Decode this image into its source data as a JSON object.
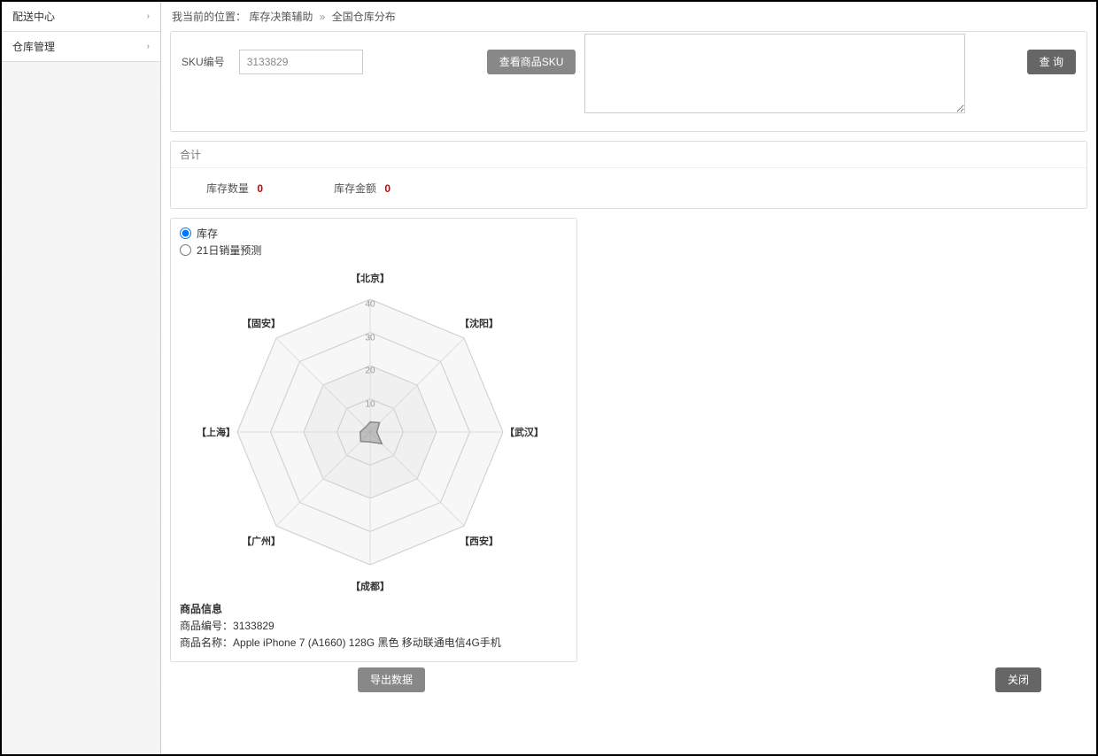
{
  "sidebar": {
    "items": [
      {
        "label": "配送中心"
      },
      {
        "label": "仓库管理"
      }
    ]
  },
  "breadcrumb": {
    "prefix": "我当前的位置：",
    "part1": "库存决策辅助",
    "sep": "»",
    "part2": "全国仓库分布"
  },
  "search": {
    "sku_label": "SKU编号",
    "sku_value": "3133829",
    "btn_view_sku": "查看商品SKU",
    "notes_value": "",
    "btn_search": "查 询"
  },
  "stats": {
    "header": "合计",
    "qty_label": "库存数量",
    "qty_value": "0",
    "amt_label": "库存金额",
    "amt_value": "0"
  },
  "chart": {
    "radio_stock": "库存",
    "radio_sales": "21日销量预测"
  },
  "chart_data": {
    "type": "radar",
    "categories": [
      "【北京】",
      "【沈阳】",
      "【武汉】",
      "【西安】",
      "【成都】",
      "【广州】",
      "【上海】",
      "【固安】"
    ],
    "rings": [
      10,
      20,
      30,
      40
    ],
    "series": [
      {
        "name": "库存",
        "values": [
          3,
          4,
          2,
          5,
          3,
          4,
          3,
          2
        ]
      }
    ]
  },
  "prod": {
    "title": "商品信息",
    "code_label": "商品编号：",
    "code_value": "3133829",
    "name_label": "商品名称：",
    "name_value": "Apple iPhone 7 (A1660) 128G 黑色 移动联通电信4G手机"
  },
  "footer": {
    "export": "导出数据",
    "close": "关闭"
  }
}
